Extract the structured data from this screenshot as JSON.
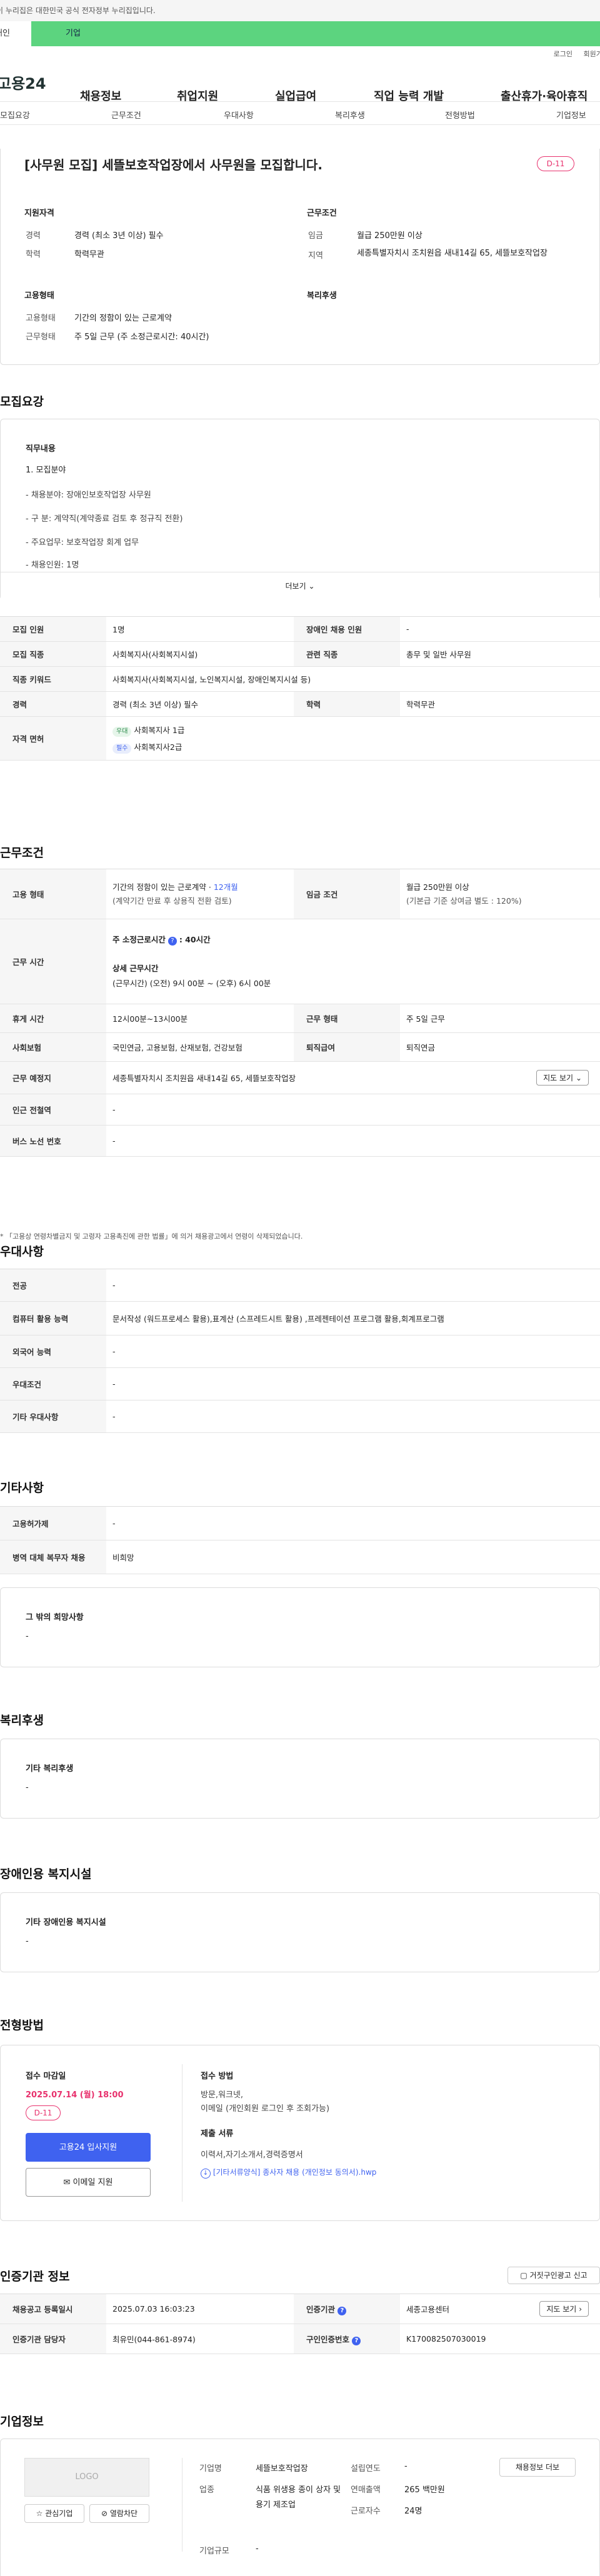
{
  "gov_banner": "이 누리집은 대한민국 공식 전자정부 누리집입니다.",
  "tabs": {
    "individual": "개인",
    "business": "기업"
  },
  "util": {
    "login": "로그인",
    "join": "회원가입"
  },
  "logo": "고용24",
  "gnb": [
    "채용정보",
    "취업지원",
    "실업급여",
    "직업 능력 개발",
    "출산휴가·육아휴직"
  ],
  "subnav": [
    "모집요강",
    "근무조건",
    "우대사항",
    "복리후생",
    "전형방법",
    "기업정보"
  ],
  "summary": {
    "title": "[사무원 모집] 세뜰보호작업장에서 사무원을 모집합니다.",
    "dday": "D-11",
    "qual_head": "지원자격",
    "career_label": "경력",
    "career_value": "경력 (최소 3년 이상) 필수",
    "edu_label": "학력",
    "edu_value": "학력무관",
    "cond_head": "근무조건",
    "wage_label": "임금",
    "wage_value": "월급 250만원 이상",
    "region_label": "지역",
    "region_value": "세종특별자치시 조치원읍 새내14길 65, 세뜰보호작업장",
    "emp_head": "고용형태",
    "emptype_label": "고용형태",
    "emptype_value": "기간의 정함이 있는 근로계약",
    "worktype_label": "근무형태",
    "worktype_value": "주 5일 근무 (주 소정근로시간: 40시간)",
    "welfare_head": "복리후생"
  },
  "recruit": {
    "heading": "모집요강",
    "duty_head": "직무내용",
    "duty_lines": [
      "1. 모집분야",
      "- 채용분야: 장애인보호작업장 사무원",
      "- 구 분: 계약직(계약종료 검토 후 정규직 전환)",
      "- 주요업무: 보호작업장 회계 업무",
      "- 채용인원: 1명"
    ],
    "more": "더보기",
    "rows": [
      {
        "k1": "모집 인원",
        "v1": "1명",
        "k2": "장애인 채용 인원",
        "v2": "-"
      },
      {
        "k1": "모집 직종",
        "v1": "사회복지사(사회복지시설)",
        "k2": "관련 직종",
        "v2": "총무 및 일반 사무원"
      },
      {
        "k1": "직종 키워드",
        "v1": "사회복지사(사회복지시설, 노인복지시설, 장애인복지시설 등)"
      },
      {
        "k1": "경력",
        "v1": "경력 (최소 3년 이상) 필수",
        "k2": "학력",
        "v2": "학력무관"
      }
    ],
    "license_label": "자격 면허",
    "licenses": [
      {
        "tag": "우대",
        "name": "사회복지사 1급"
      },
      {
        "tag": "필수",
        "name": "사회복지사2급"
      }
    ]
  },
  "work": {
    "heading": "근무조건",
    "emp_label": "고용 형태",
    "emp_v1": "기간의 정함이 있는 근로계약 · ",
    "emp_months": "12개월",
    "emp_v2": "(계약기간 만료 후 상용직 전환 검토)",
    "wage_label": "임금 조건",
    "wage_v1": "월급 250만원 이상",
    "wage_v2": "(기본급 기준 상여금 별도 : 120%)",
    "hours_label": "근무 시간",
    "hours_total": "주 소정근로시간",
    "hours_total_v": ": 40시간",
    "hours_detail_head": "상세 근무시간",
    "hours_detail": "(근무시간) (오전) 9시 00분 ~ (오후) 6시 00분",
    "break_label": "휴게 시간",
    "break_v": "12시00분~13시00분",
    "form_label": "근무 형태",
    "form_v": "주 5일 근무",
    "ins_label": "사회보험",
    "ins_v": "국민연금, 고용보험, 산재보험, 건강보험",
    "ret_label": "퇴직급여",
    "ret_v": "퇴직연금",
    "place_label": "근무 예정지",
    "place_v": "세종특별자치시 조치원읍 새내14길 65, 세뜰보호작업장",
    "map_btn": "지도 보기",
    "station_label": "인근 전철역",
    "station_v": "-",
    "bus_label": "버스 노선 번호",
    "bus_v": "-",
    "notice": "* 「고용상 연령차별금지 및 고령자 고용촉진에 관한 법률」에 의거 채용광고에서 연령이 삭제되었습니다."
  },
  "pref": {
    "heading": "우대사항",
    "rows": [
      {
        "k": "전공",
        "v": "-"
      },
      {
        "k": "컴퓨터 활용 능력",
        "v": "문서작성 (워드프로세스 활용),표계산 (스프레드시트 활용) ,프레젠테이션 프로그램 활용,회계프로그램"
      },
      {
        "k": "외국어 능력",
        "v": "-"
      },
      {
        "k": "우대조건",
        "v": "-"
      },
      {
        "k": "기타 우대사항",
        "v": "-"
      }
    ]
  },
  "etc": {
    "heading": "기타사항",
    "rows": [
      {
        "k": "고용허가제",
        "v": "-"
      },
      {
        "k": "병역 대체 복무자 채용",
        "v": "비희망"
      }
    ],
    "other_head": "그 밖의 희망사항",
    "other_v": "-"
  },
  "welfare": {
    "heading": "복리후생",
    "head": "기타 복리후생",
    "v": "-"
  },
  "disability": {
    "heading": "장애인용 복지시설",
    "head": "기타 장애인용 복지시설",
    "v": "-"
  },
  "screening": {
    "heading": "전형방법",
    "deadline_head": "접수 마감일",
    "deadline": "2025.07.14 (월) 18:00",
    "dday": "D-11",
    "apply_btn": "고용24 입사지원",
    "email_btn": "이메일 지원",
    "method_head": "접수 방법",
    "method_v1": "방문,워크넷,",
    "method_v2": "이메일 (개인회원 로그인 후 조회가능)",
    "docs_head": "제출 서류",
    "docs_v": "이력서,자기소개서,경력증명서",
    "docs_link": "[기타서류양식] 종사자 채용 (개인정보 동의서).hwp"
  },
  "cert": {
    "heading": "인증기관 정보",
    "report_btn": "거짓구인광고 신고",
    "reg_label": "채용공고 등록일시",
    "reg_v": "2025.07.03 16:03:23",
    "org_label": "인증기관",
    "org_v": "세종고용센터",
    "map_btn": "지도 보기",
    "staff_label": "인증기관 담당자",
    "staff_v": "최유민(044-861-8974)",
    "no_label": "구인인증번호",
    "no_v": "K170082507030019"
  },
  "company": {
    "heading": "기업정보",
    "logo": "LOGO",
    "fav_btn": "관심기업",
    "block_btn": "열람차단",
    "name_label": "기업명",
    "name_v": "세뜰보호작업장",
    "found_label": "설립연도",
    "found_v": "-",
    "ind_label": "업종",
    "ind_v": "식품 위생용 종이 상자 및 용기 제조업",
    "sales_label": "연매출액",
    "sales_v": "265 백만원",
    "emp_label": "근로자수",
    "emp_v": "24명",
    "size_label": "기업규모",
    "size_v": "-",
    "list_btn": "채용정보 더보"
  },
  "colors": {
    "accent": "#5cd47f",
    "dday": "#e8326e",
    "primary": "#3f62f0",
    "link": "#3f62f0"
  }
}
